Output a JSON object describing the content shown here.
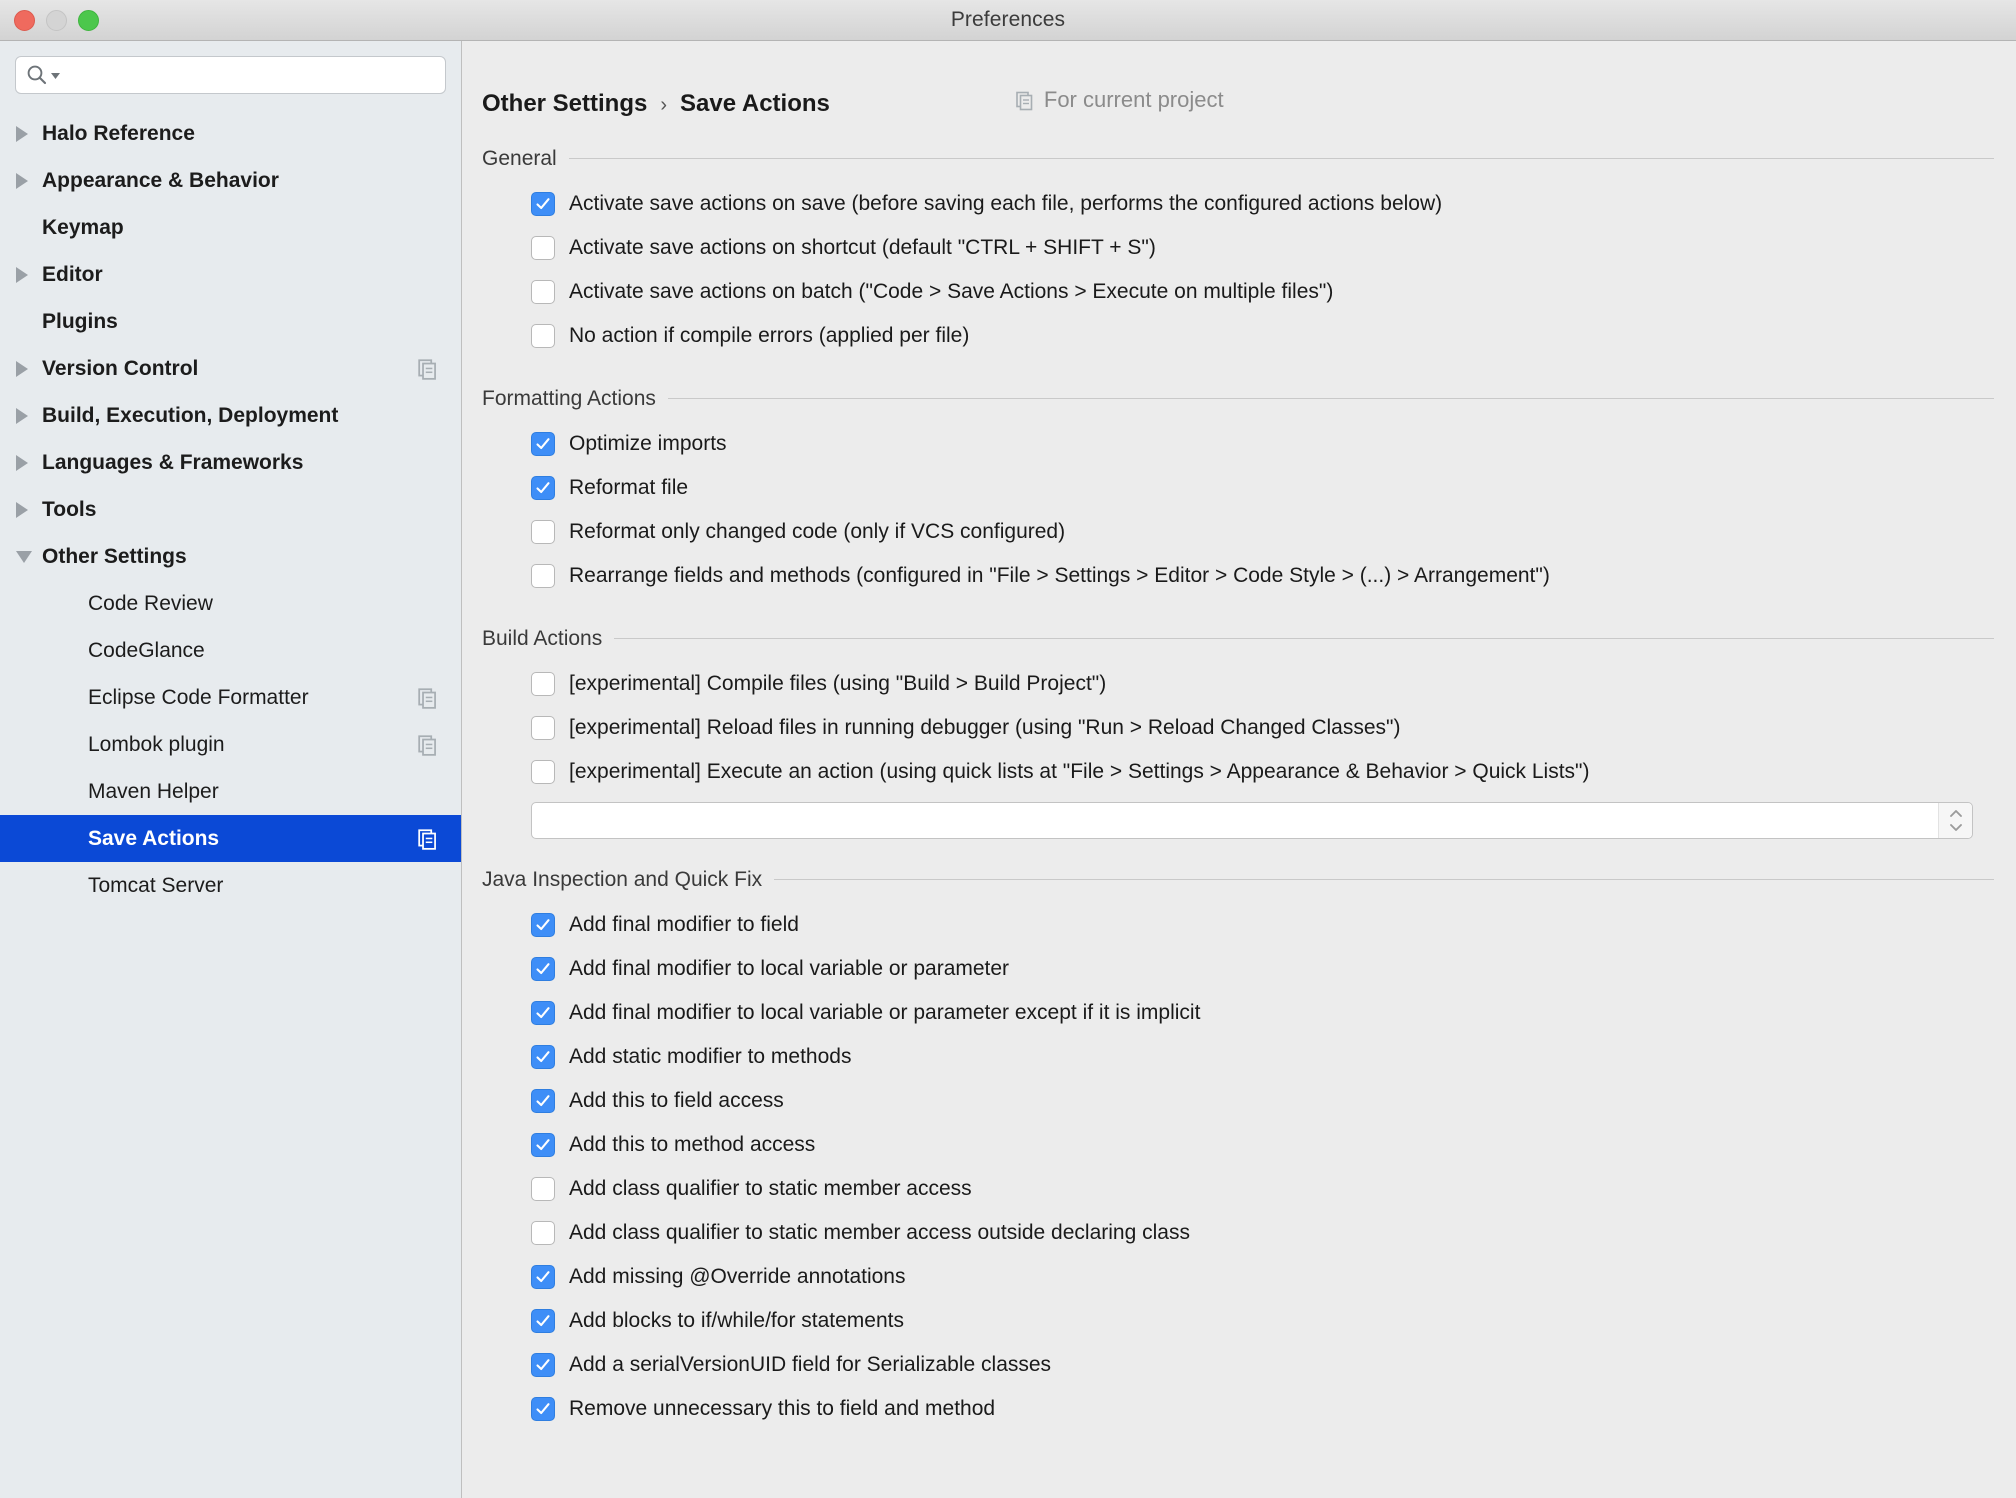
{
  "window": {
    "title": "Preferences",
    "traffic_lights": [
      "close-button",
      "minimize-button",
      "zoom-button"
    ]
  },
  "search": {
    "value": "",
    "placeholder": "",
    "icon": "search-icon"
  },
  "sidebar": {
    "items": [
      {
        "label": "Halo Reference",
        "level": "top",
        "twisty": "right",
        "selected": false,
        "project_icon": false
      },
      {
        "label": "Appearance & Behavior",
        "level": "top",
        "twisty": "right",
        "selected": false,
        "project_icon": false
      },
      {
        "label": "Keymap",
        "level": "top",
        "twisty": "none",
        "selected": false,
        "project_icon": false
      },
      {
        "label": "Editor",
        "level": "top",
        "twisty": "right",
        "selected": false,
        "project_icon": false
      },
      {
        "label": "Plugins",
        "level": "top",
        "twisty": "none",
        "selected": false,
        "project_icon": false
      },
      {
        "label": "Version Control",
        "level": "top",
        "twisty": "right",
        "selected": false,
        "project_icon": true
      },
      {
        "label": "Build, Execution, Deployment",
        "level": "top",
        "twisty": "right",
        "selected": false,
        "project_icon": false
      },
      {
        "label": "Languages & Frameworks",
        "level": "top",
        "twisty": "right",
        "selected": false,
        "project_icon": false
      },
      {
        "label": "Tools",
        "level": "top",
        "twisty": "right",
        "selected": false,
        "project_icon": false
      },
      {
        "label": "Other Settings",
        "level": "top",
        "twisty": "down",
        "selected": false,
        "project_icon": false
      },
      {
        "label": "Code Review",
        "level": "child",
        "twisty": "none",
        "selected": false,
        "project_icon": false
      },
      {
        "label": "CodeGlance",
        "level": "child",
        "twisty": "none",
        "selected": false,
        "project_icon": false
      },
      {
        "label": "Eclipse Code Formatter",
        "level": "child",
        "twisty": "none",
        "selected": false,
        "project_icon": true
      },
      {
        "label": "Lombok plugin",
        "level": "child",
        "twisty": "none",
        "selected": false,
        "project_icon": true
      },
      {
        "label": "Maven Helper",
        "level": "child",
        "twisty": "none",
        "selected": false,
        "project_icon": false
      },
      {
        "label": "Save Actions",
        "level": "child",
        "twisty": "none",
        "selected": true,
        "project_icon": true
      },
      {
        "label": "Tomcat Server",
        "level": "child",
        "twisty": "none",
        "selected": false,
        "project_icon": false
      }
    ]
  },
  "header": {
    "breadcrumb_parent": "Other Settings",
    "breadcrumb_sep": "›",
    "breadcrumb_current": "Save Actions",
    "scope_label": "For current project",
    "scope_icon": "project-scope-icon"
  },
  "sections": [
    {
      "title": "General",
      "rows": [
        {
          "checked": true,
          "label": "Activate save actions on save (before saving each file, performs the configured actions below)"
        },
        {
          "checked": false,
          "label": "Activate save actions on shortcut (default \"CTRL + SHIFT + S\")"
        },
        {
          "checked": false,
          "label": "Activate save actions on batch (\"Code > Save Actions > Execute on multiple files\")"
        },
        {
          "checked": false,
          "label": "No action if compile errors (applied per file)"
        }
      ]
    },
    {
      "title": "Formatting Actions",
      "rows": [
        {
          "checked": true,
          "label": "Optimize imports"
        },
        {
          "checked": true,
          "label": "Reformat file"
        },
        {
          "checked": false,
          "label": "Reformat only changed code (only if VCS configured)"
        },
        {
          "checked": false,
          "label": "Rearrange fields and methods (configured in \"File > Settings > Editor > Code Style > (...) > Arrangement\")"
        }
      ]
    },
    {
      "title": "Build Actions",
      "rows": [
        {
          "checked": false,
          "label": "[experimental] Compile files (using \"Build > Build Project\")"
        },
        {
          "checked": false,
          "label": "[experimental] Reload files in running debugger (using \"Run > Reload Changed Classes\")"
        },
        {
          "checked": false,
          "label": "[experimental] Execute an action (using quick lists at \"File > Settings > Appearance & Behavior > Quick Lists\")"
        }
      ],
      "combo": {
        "value": "",
        "placeholder": "",
        "stepper_icon": "stepper-updown-icon"
      }
    },
    {
      "title": "Java Inspection and Quick Fix",
      "rows": [
        {
          "checked": true,
          "label": "Add final modifier to field"
        },
        {
          "checked": true,
          "label": "Add final modifier to local variable or parameter"
        },
        {
          "checked": true,
          "label": "Add final modifier to local variable or parameter except if it is implicit"
        },
        {
          "checked": true,
          "label": "Add static modifier to methods"
        },
        {
          "checked": true,
          "label": "Add this to field access"
        },
        {
          "checked": true,
          "label": "Add this to method access"
        },
        {
          "checked": false,
          "label": "Add class qualifier to static member access"
        },
        {
          "checked": false,
          "label": "Add class qualifier to static member access outside declaring class"
        },
        {
          "checked": true,
          "label": "Add missing @Override annotations"
        },
        {
          "checked": true,
          "label": "Add blocks to if/while/for statements"
        },
        {
          "checked": true,
          "label": "Add a serialVersionUID field for Serializable classes"
        },
        {
          "checked": true,
          "label": "Remove unnecessary this to field and method"
        }
      ]
    }
  ],
  "colors": {
    "selection_blue": "#0b49d6",
    "checkbox_blue": "#3e8ef7",
    "sidebar_bg": "#e7ebee",
    "panel_bg": "#ececec"
  }
}
